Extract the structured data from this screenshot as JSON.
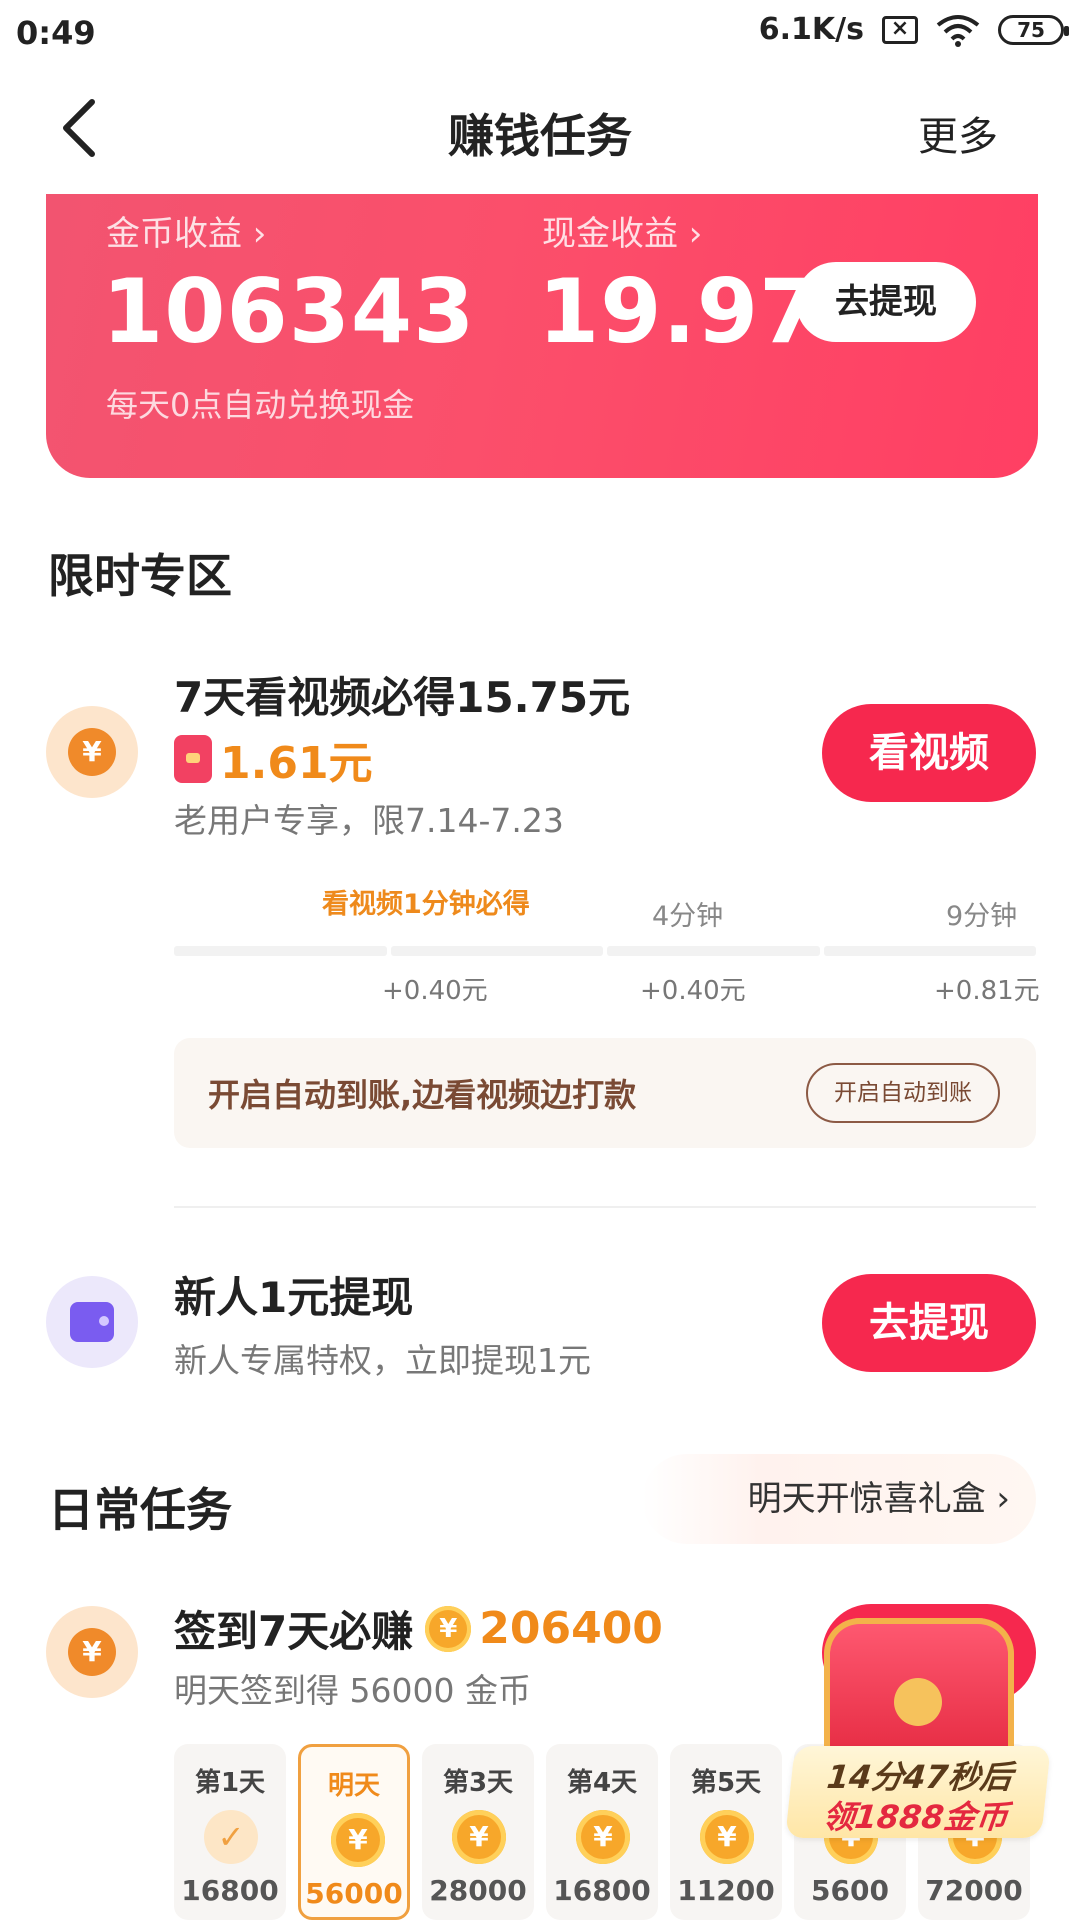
{
  "status_bar": {
    "time": "0:49",
    "speed": "6.1K/s",
    "battery": "75"
  },
  "nav": {
    "title": "赚钱任务",
    "more": "更多"
  },
  "earnings": {
    "coin_label": "金币收益 ›",
    "coin_value": "106343",
    "cash_label": "现金收益 ›",
    "cash_value": "19.97",
    "withdraw_btn": "去提现",
    "note": "每天0点自动兑换现金"
  },
  "limited": {
    "title": "限时专区",
    "video_task": {
      "title": "7天看视频必得15.75元",
      "reward": "1.61元",
      "subtitle": "老用户专享，限7.14-7.23",
      "button": "看视频",
      "milestones": [
        {
          "label": "看视频1分钟必得",
          "reward": "+0.40元"
        },
        {
          "label": "4分钟",
          "reward": "+0.40元"
        },
        {
          "label": "9分钟",
          "reward": "+0.81元"
        }
      ],
      "auto_text": "开启自动到账,边看视频边打款",
      "auto_button": "开启自动到账"
    },
    "newbie_task": {
      "title": "新人1元提现",
      "subtitle": "新人专属特权，立即提现1元",
      "button": "去提现"
    }
  },
  "daily": {
    "title": "日常任务",
    "surprise": "明天开惊喜礼盒 ›",
    "signin": {
      "title": "签到7天必赚",
      "total": "206400",
      "subtitle": "明天签到得 56000 金币",
      "days": [
        {
          "label": "第1天",
          "value": "16800",
          "done": true
        },
        {
          "label": "明天",
          "value": "56000",
          "active": true
        },
        {
          "label": "第3天",
          "value": "28000"
        },
        {
          "label": "第4天",
          "value": "16800"
        },
        {
          "label": "第5天",
          "value": "11200"
        },
        {
          "label": "",
          "value": "5600"
        },
        {
          "label": "",
          "value": "72000"
        }
      ],
      "timer_line1": "14分47秒后",
      "timer_line2": "领1888金币"
    }
  },
  "colors": {
    "accent_red": "#f6284e",
    "accent_orange": "#f08a1a",
    "card_pink": "#fb4f6b"
  }
}
